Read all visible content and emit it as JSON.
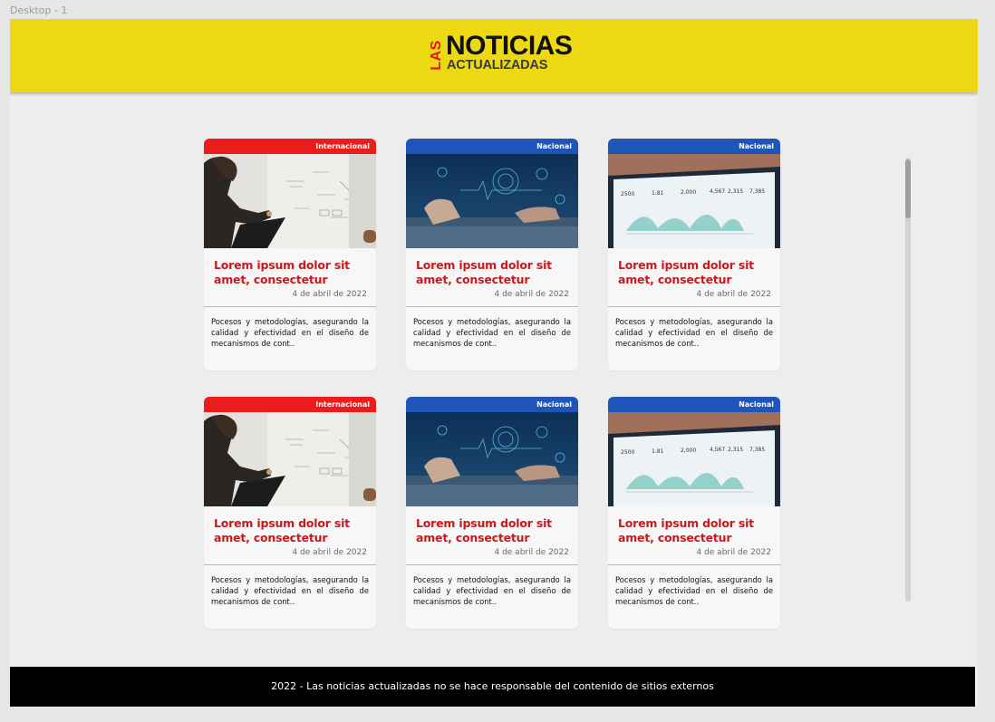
{
  "canvas": {
    "frame_label": "Desktop - 1"
  },
  "header": {
    "logo_top": "LAS",
    "logo_main": "NOTICIAS",
    "logo_sub": "ACTUALIZADAS"
  },
  "cards": [
    {
      "category": "Internacional",
      "title": "Lorem ipsum dolor sit amet, consectetur",
      "date": "4 de abril de 2022",
      "description": "Pocesos y metodologías, asegurando la calidad y efectividad en el diseño de mecanismos de cont.."
    },
    {
      "category": "Nacional",
      "title": "Lorem ipsum dolor sit amet, consectetur",
      "date": "4 de abril de 2022",
      "description": "Pocesos y metodologías, asegurando la calidad y efectividad en el diseño de mecanismos de cont.."
    },
    {
      "category": "Nacional",
      "title": "Lorem ipsum dolor sit amet, consectetur",
      "date": "4 de abril de 2022",
      "description": "Pocesos y metodologías, asegurando la calidad y efectividad en el diseño de mecanismos de cont.."
    },
    {
      "category": "Internacional",
      "title": "Lorem ipsum dolor sit amet, consectetur",
      "date": "4 de abril de 2022",
      "description": "Pocesos y metodologías, asegurando la calidad y efectividad en el diseño de mecanismos de cont.."
    },
    {
      "category": "Nacional",
      "title": "Lorem ipsum dolor sit amet, consectetur",
      "date": "4 de abril de 2022",
      "description": "Pocesos y metodologías, asegurando la calidad y efectividad en el diseño de mecanismos de cont.."
    },
    {
      "category": "Nacional",
      "title": "Lorem ipsum dolor sit amet, consectetur",
      "date": "4 de abril de 2022",
      "description": "Pocesos y metodologías, asegurando la calidad y efectividad en el diseño de mecanismos de cont.."
    }
  ],
  "footer": {
    "text": "2022  -  Las noticias actualizadas no se hace responsable del contenido de sitios externos"
  },
  "colors": {
    "header_bg": "#ecd813",
    "internacional": "#ea1c1c",
    "nacional": "#1f54b8",
    "title_red": "#c9191c",
    "footer_bg": "#000000"
  }
}
